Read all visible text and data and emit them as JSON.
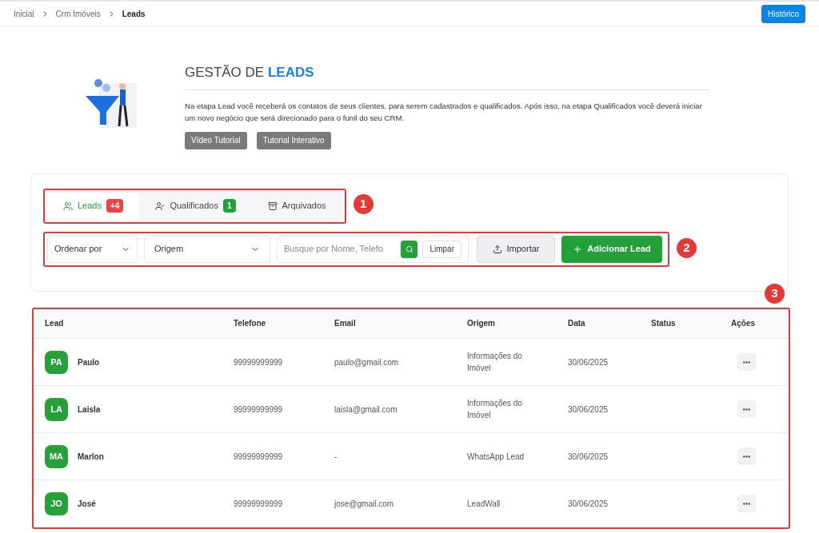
{
  "breadcrumb": [
    {
      "label": "Inicial",
      "current": false
    },
    {
      "label": "Crm Imóveis",
      "current": false
    },
    {
      "label": "Leads",
      "current": true
    }
  ],
  "history_button": "Histórico",
  "header": {
    "title": "GESTÃO DE",
    "title_highlight": "LEADS",
    "description": "Na etapa Lead você receberá os contatos de seus clientes, para serem cadastrados e qualificados. Após isso, na etapa Qualificados você deverá iniciar um novo negócio que será direcionado para o funil do seu CRM.",
    "buttons": [
      "Vídeo Tutorial",
      "Tutorial Interativo"
    ]
  },
  "annotations": [
    "1",
    "2",
    "3"
  ],
  "tabs": [
    {
      "label": "Leads",
      "badge": "+4",
      "color": "#ef4444",
      "selected": true,
      "kind": "users"
    },
    {
      "label": "Qualificados",
      "badge": "1",
      "color": "#22a03a",
      "selected": false,
      "kind": "user-check"
    },
    {
      "label": "Arquivados",
      "selected": false,
      "kind": "archive"
    }
  ],
  "toolbar": {
    "sort": {
      "value": "Ordenar por"
    },
    "origin": {
      "value": "Origem"
    },
    "search": {
      "placeholder": "Busque por Nome, Telefo"
    },
    "clear_button": "Limpar",
    "import_button": "Importar",
    "add_button": "Adicionar Lead"
  },
  "table": {
    "columns": [
      "Lead",
      "Telefone",
      "Email",
      "Origem",
      "Data",
      "Status",
      "Ações"
    ],
    "rows": [
      {
        "initials": "PA",
        "name": "Paulo",
        "phone": "99999999999",
        "email": "paulo@gmail.com",
        "origin": "Informações do Imóvel",
        "date": "30/06/2025"
      },
      {
        "initials": "LA",
        "name": "Laisla",
        "phone": "99999999999",
        "email": "laisla@gmail.com",
        "origin": "Informações do Imóvel",
        "date": "30/06/2025"
      },
      {
        "initials": "MA",
        "name": "Marlon",
        "phone": "99999999999",
        "email": "-",
        "origin": "WhatsApp Lead",
        "date": "30/06/2025"
      },
      {
        "initials": "JO",
        "name": "José",
        "phone": "99999999999",
        "email": "jose@gmail.com",
        "origin": "LeadWall",
        "date": "30/06/2025"
      }
    ]
  }
}
